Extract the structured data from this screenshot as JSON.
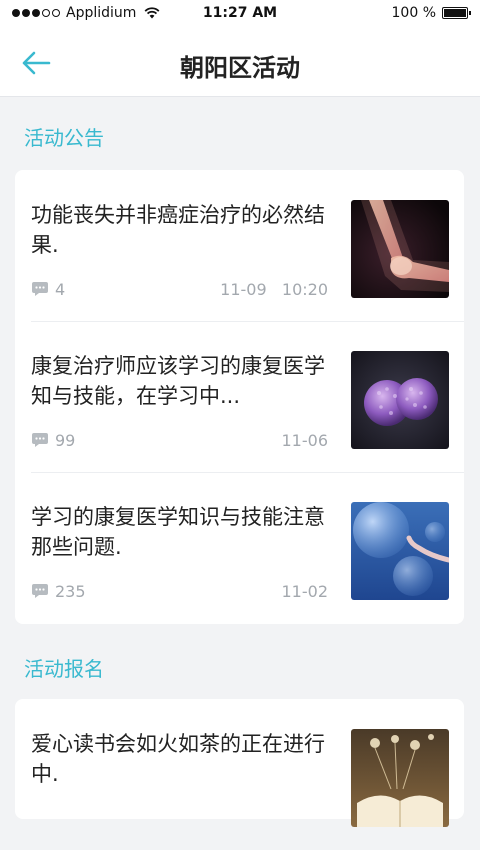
{
  "status_bar": {
    "carrier": "Applidium",
    "time": "11:27 AM",
    "battery": "100 %",
    "battery_level": 1.0
  },
  "nav": {
    "title": "朝阳区活动",
    "back_icon": "back-arrow-icon"
  },
  "sections": [
    {
      "title": "活动公告",
      "items": [
        {
          "title": "功能丧失并非癌症治疗的必然结果.",
          "comments": "4",
          "date": "11-09   10:20",
          "thumb": "xray-elbow-thumbnail"
        },
        {
          "title": "康复治疗师应该学习的康复医学知与技能，在学习中...",
          "comments": "99",
          "date": "11-06",
          "thumb": "cell-microscopy-thumbnail"
        },
        {
          "title": "学习的康复医学知识与技能注意那些问题.",
          "comments": "235",
          "date": "11-02",
          "thumb": "blue-bubbles-thumbnail"
        }
      ]
    },
    {
      "title": "活动报名",
      "items": [
        {
          "title": "爱心读书会如火如茶的正在进行中.",
          "thumb": "open-book-thumbnail"
        }
      ]
    }
  ],
  "colors": {
    "accent": "#39b9cf",
    "background": "#f2f3f5",
    "meta_text": "#a3a8ae"
  }
}
